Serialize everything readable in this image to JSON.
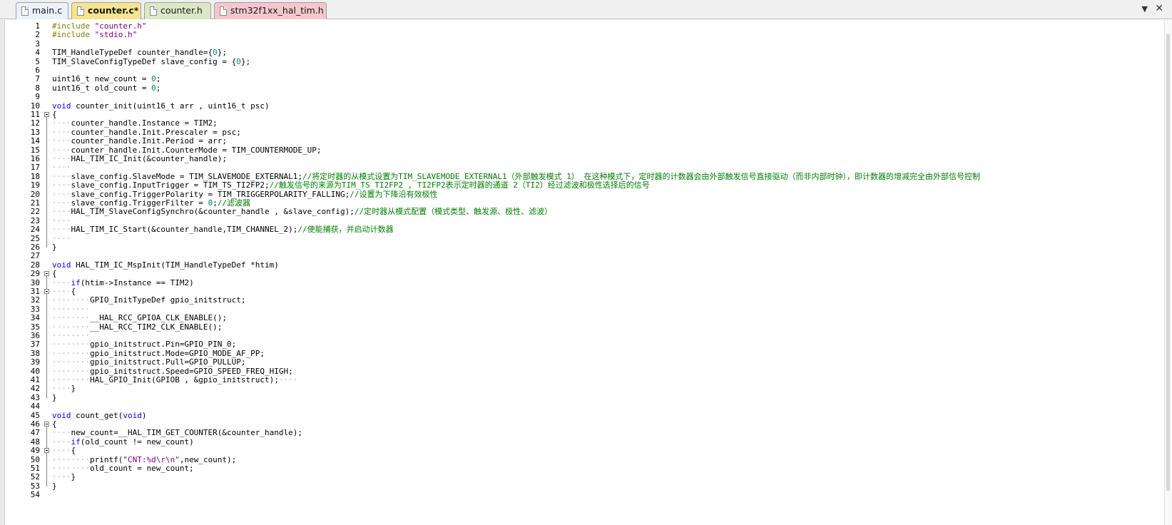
{
  "tabs": [
    {
      "label": "main.c",
      "bg": "#ecf2fa"
    },
    {
      "label": "counter.c*",
      "bg": "#f7e48f",
      "active": true
    },
    {
      "label": "counter.h",
      "bg": "#dbe8c5"
    },
    {
      "label": "stm32f1xx_hal_tim.h",
      "bg": "#f4c7cd"
    }
  ],
  "tab_close_icon": "close-icon",
  "tab_menu_icon": "chevron-down-icon",
  "code_lines": [
    [
      [
        "pp",
        "#include "
      ],
      [
        "str",
        "\"counter.h\""
      ]
    ],
    [
      [
        "pp",
        "#include "
      ],
      [
        "str",
        "\"stdio.h\""
      ]
    ],
    [],
    [
      [
        "t",
        "TIM_HandleTypeDef counter_handle={"
      ],
      [
        "num",
        "0"
      ],
      [
        "t",
        "};"
      ]
    ],
    [
      [
        "t",
        "TIM_SlaveConfigTypeDef slave_config = {"
      ],
      [
        "num",
        "0"
      ],
      [
        "t",
        "};"
      ]
    ],
    [],
    [
      [
        "t",
        "uint16_t new_count = "
      ],
      [
        "num",
        "0"
      ],
      [
        "t",
        ";"
      ]
    ],
    [
      [
        "t",
        "uint16_t old_count = "
      ],
      [
        "num",
        "0"
      ],
      [
        "t",
        ";"
      ]
    ],
    [],
    [
      [
        "kw",
        "void"
      ],
      [
        "t",
        " counter_init(uint16_t arr , uint16_t psc)"
      ]
    ],
    [
      [
        "t",
        "{"
      ]
    ],
    [
      [
        "ws",
        "····"
      ],
      [
        "t",
        "counter_handle.Instance = TIM2;"
      ]
    ],
    [
      [
        "ws",
        "····"
      ],
      [
        "t",
        "counter_handle.Init.Prescaler = psc;"
      ]
    ],
    [
      [
        "ws",
        "····"
      ],
      [
        "t",
        "counter_handle.Init.Period = arr;"
      ]
    ],
    [
      [
        "ws",
        "····"
      ],
      [
        "t",
        "counter_handle.Init.CounterMode = TIM_COUNTERMODE_UP;"
      ]
    ],
    [
      [
        "ws",
        "····"
      ],
      [
        "t",
        "HAL_TIM_IC_Init(&counter_handle);"
      ]
    ],
    [
      [
        "ws",
        "····"
      ]
    ],
    [
      [
        "ws",
        "····"
      ],
      [
        "t",
        "slave_config.SlaveMode = TIM_SLAVEMODE_EXTERNAL1;"
      ],
      [
        "cm",
        "//将定时器的从模式设置为TIM_SLAVEMODE_EXTERNAL1（外部触发模式 1） 在这种模式下，定时器的计数器会由外部触发信号直接驱动（而非内部时钟），即计数器的增减完全由外部信号控制"
      ]
    ],
    [
      [
        "ws",
        "····"
      ],
      [
        "t",
        "slave_config.InputTrigger = TIM_TS_TI2FP2;"
      ],
      [
        "cm",
        "//触发信号的来源为TIM_TS_TI2FP2 , TI2FP2表示定时器的通道 2（TI2）经过滤波和极性选择后的信号"
      ]
    ],
    [
      [
        "ws",
        "····"
      ],
      [
        "t",
        "slave_config.TriggerPolarity = TIM_TRIGGERPOLARITY_FALLING;"
      ],
      [
        "cm",
        "//设置为下降沿有效极性"
      ]
    ],
    [
      [
        "ws",
        "····"
      ],
      [
        "t",
        "slave_config.TriggerFilter = "
      ],
      [
        "num",
        "0"
      ],
      [
        "t",
        ";"
      ],
      [
        "cm",
        "//滤波器"
      ]
    ],
    [
      [
        "ws",
        "····"
      ],
      [
        "t",
        "HAL_TIM_SlaveConfigSynchro(&counter_handle , &slave_config);"
      ],
      [
        "cm",
        "//定时器从模式配置（模式类型、触发源、极性、滤波）"
      ]
    ],
    [
      [
        "ws",
        "····"
      ]
    ],
    [
      [
        "ws",
        "····"
      ],
      [
        "t",
        "HAL_TIM_IC_Start(&counter_handle,TIM_CHANNEL_2);"
      ],
      [
        "cm",
        "//使能捕获，并启动计数器"
      ]
    ],
    [
      [
        "ws",
        "····"
      ]
    ],
    [
      [
        "t",
        "}"
      ]
    ],
    [],
    [
      [
        "kw",
        "void"
      ],
      [
        "t",
        " HAL_TIM_IC_MspInit(TIM_HandleTypeDef *htim)"
      ]
    ],
    [
      [
        "t",
        "{"
      ]
    ],
    [
      [
        "ws",
        "····"
      ],
      [
        "kw",
        "if"
      ],
      [
        "t",
        "(htim->Instance == TIM2)"
      ]
    ],
    [
      [
        "ws",
        "····"
      ],
      [
        "t",
        "{"
      ]
    ],
    [
      [
        "ws",
        "········"
      ],
      [
        "t",
        "GPIO_InitTypeDef gpio_initstruct;"
      ]
    ],
    [
      [
        "ws",
        "········"
      ]
    ],
    [
      [
        "ws",
        "········"
      ],
      [
        "t",
        "__HAL_RCC_GPIOA_CLK_ENABLE();"
      ]
    ],
    [
      [
        "ws",
        "········"
      ],
      [
        "t",
        "__HAL_RCC_TIM2_CLK_ENABLE();"
      ]
    ],
    [
      [
        "ws",
        "········"
      ]
    ],
    [
      [
        "ws",
        "········"
      ],
      [
        "t",
        "gpio_initstruct.Pin=GPIO_PIN_0;"
      ]
    ],
    [
      [
        "ws",
        "········"
      ],
      [
        "t",
        "gpio_initstruct.Mode=GPIO_MODE_AF_PP;"
      ]
    ],
    [
      [
        "ws",
        "········"
      ],
      [
        "t",
        "gpio_initstruct.Pull=GPIO_PULLUP;"
      ]
    ],
    [
      [
        "ws",
        "········"
      ],
      [
        "t",
        "gpio_initstruct.Speed=GPIO_SPEED_FREQ_HIGH;"
      ]
    ],
    [
      [
        "ws",
        "········"
      ],
      [
        "t",
        "HAL_GPIO_Init(GPIOB , &gpio_initstruct);"
      ],
      [
        "ws",
        "····"
      ]
    ],
    [
      [
        "ws",
        "····"
      ],
      [
        "t",
        "}"
      ]
    ],
    [
      [
        "t",
        "}"
      ]
    ],
    [],
    [
      [
        "kw",
        "void"
      ],
      [
        "t",
        " count_get("
      ],
      [
        "kw",
        "void"
      ],
      [
        "t",
        ")"
      ]
    ],
    [
      [
        "t",
        "{"
      ]
    ],
    [
      [
        "ws",
        "····"
      ],
      [
        "t",
        "new_count=__HAL_TIM_GET_COUNTER(&counter_handle);"
      ]
    ],
    [
      [
        "ws",
        "····"
      ],
      [
        "kw",
        "if"
      ],
      [
        "t",
        "(old_count != new_count)"
      ]
    ],
    [
      [
        "ws",
        "····"
      ],
      [
        "t",
        "{"
      ]
    ],
    [
      [
        "ws",
        "········"
      ],
      [
        "t",
        "printf("
      ],
      [
        "str",
        "\"CNT:%d\\r\\n\""
      ],
      [
        "t",
        ",new_count);"
      ]
    ],
    [
      [
        "ws",
        "········"
      ],
      [
        "t",
        "old_count = new_count;"
      ]
    ],
    [
      [
        "ws",
        "····"
      ],
      [
        "t",
        "}"
      ]
    ],
    [
      [
        "t",
        "}"
      ]
    ],
    []
  ],
  "fold_markers": [
    11,
    29,
    31,
    46,
    49
  ]
}
